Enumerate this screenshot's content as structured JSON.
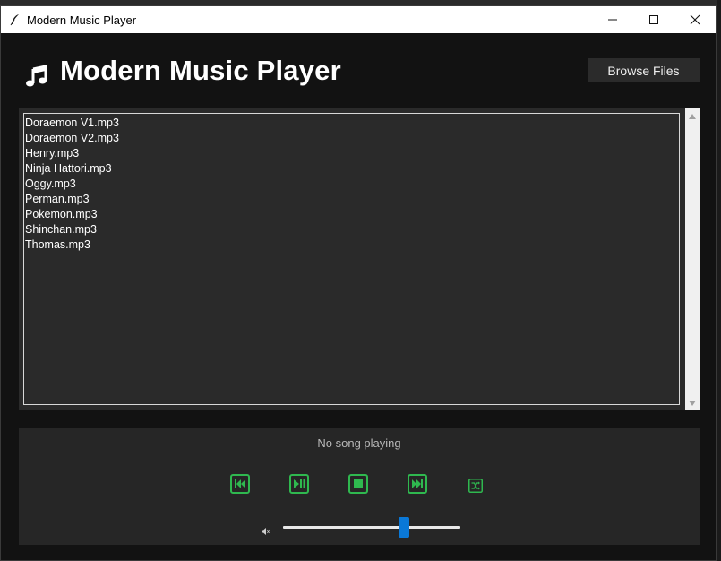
{
  "window": {
    "title": "Modern Music Player"
  },
  "header": {
    "app_name": "Modern Music Player",
    "browse_label": "Browse Files"
  },
  "playlist": {
    "items": [
      "Doraemon V1.mp3",
      "Doraemon V2.mp3",
      "Henry.mp3",
      "Ninja Hattori.mp3",
      "Oggy.mp3",
      "Perman.mp3",
      "Pokemon.mp3",
      "Shinchan.mp3",
      "Thomas.mp3"
    ]
  },
  "player": {
    "status": "No song playing",
    "volume_level": 0.68
  },
  "colors": {
    "accent_green": "#2fb84f",
    "slider_blue": "#0a78d7",
    "window_bg": "#121212",
    "panel_bg": "#262626"
  },
  "icons": {
    "app": "feather-icon",
    "music": "music-note-icon",
    "previous": "skip-previous-icon",
    "play_pause": "play-pause-icon",
    "stop": "stop-icon",
    "next": "skip-next-icon",
    "shuffle": "shuffle-icon",
    "volume": "volume-icon"
  }
}
